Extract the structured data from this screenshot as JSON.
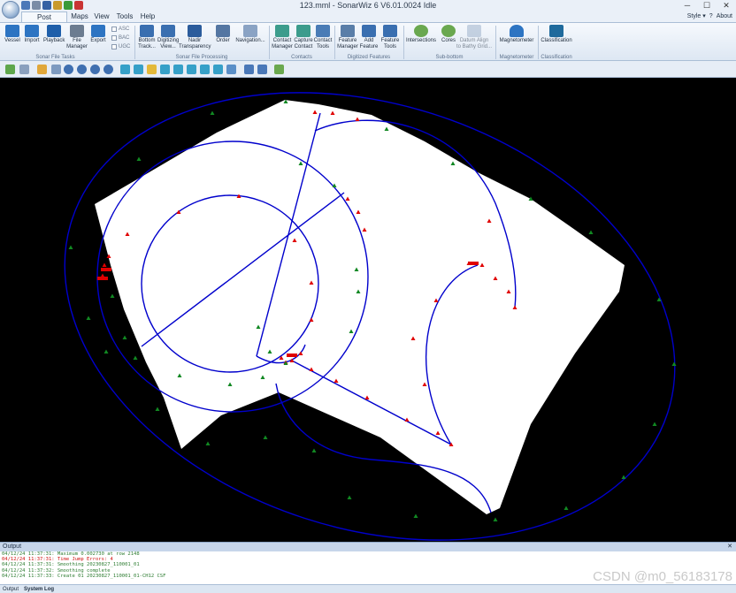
{
  "window": {
    "title": "123.mml - SonarWiz 6 V6.01.0024 Idle",
    "minimize": "─",
    "maximize": "☐",
    "close": "✕"
  },
  "menu": {
    "tabs": [
      "Post Processing",
      "Maps",
      "View",
      "Tools",
      "Help"
    ],
    "active": "Post Processing",
    "style": "Style ▾",
    "about": "About"
  },
  "ribbon": {
    "buttons": [
      "Vessel",
      "Import",
      "Playback",
      "File\nManager",
      "Export",
      "Bottom\nTrack...",
      "Digitizing\nView...",
      "Nadir\nTransparency",
      "Order",
      "Navigation...",
      "Contact\nManager",
      "Capture\nContact",
      "Contact\nTools",
      "Feature\nManager",
      "Add\nFeature",
      "Feature\nTools",
      "Intersections",
      "Cores",
      "Datum Align\nto Bathy Grid...",
      "Magnetometer",
      "Classification"
    ],
    "checks": [
      "ASC",
      "BAC",
      "UGC"
    ],
    "groups": [
      "Sonar File Tasks",
      "Sonar File Processing",
      "Contacts",
      "Digitized Features",
      "Sub-bottom",
      "Magnetometer",
      "Classification"
    ]
  },
  "colors": {
    "track_blue": "#0000cc",
    "marker_red": "#e00000",
    "marker_green": "#118822",
    "coverage_white": "#ffffff",
    "map_background": "#000000"
  },
  "output": {
    "title": "Output",
    "close": "✕",
    "log": [
      "04/12/24 11:37:31: Maximum 0.002730 at row 2148",
      "04/12/24 11:37:31: Time Jump Errors: 4",
      "04/12/24 11:37:31: Smoothing 20230827_110001_01",
      "04/12/24 11:37:32: Smoothing complete",
      "04/12/24 11:37:33: Create 01 20230827_110001_01-CH12 CSF"
    ],
    "tabs": [
      "Output",
      "System Log"
    ]
  },
  "watermark": "CSDN @m0_56183178"
}
